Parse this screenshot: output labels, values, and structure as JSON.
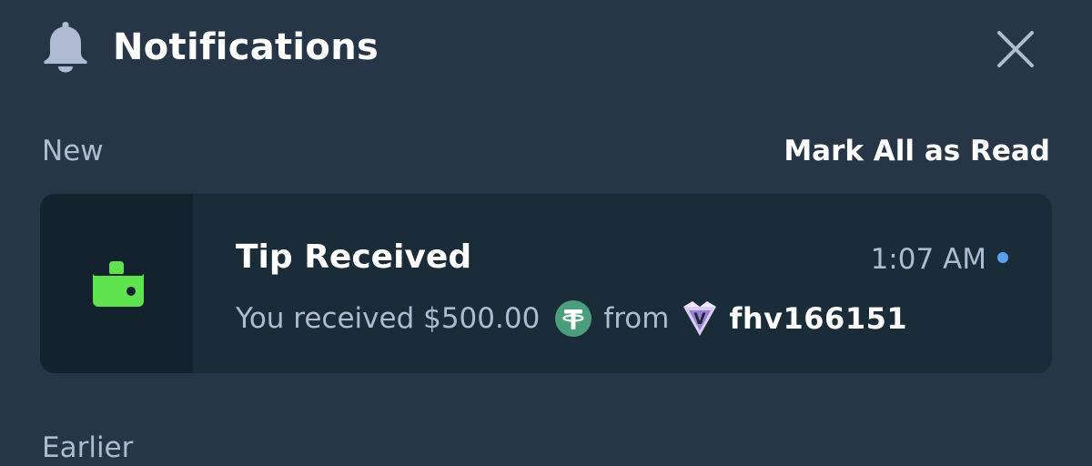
{
  "header": {
    "title": "Notifications",
    "icon": "bell-icon",
    "close_icon": "close-icon"
  },
  "sections": {
    "new_label": "New",
    "mark_all_label": "Mark All as Read",
    "earlier_label": "Earlier"
  },
  "notification": {
    "icon": "wallet-icon",
    "title": "Tip Received",
    "time": "1:07 AM",
    "unread": true,
    "body_prefix": "You received $500.00",
    "currency_icon": "tether-icon",
    "body_from": "from",
    "vip_badge_letter": "V",
    "username": "fhv166151"
  },
  "colors": {
    "background": "#263646",
    "card": "#1a2c38",
    "icon_panel": "#13222d",
    "wallet_green": "#5ee34e",
    "tether_green": "#4b9e7c",
    "unread_dot": "#5aa0f0",
    "muted_text": "#b1bad3"
  }
}
